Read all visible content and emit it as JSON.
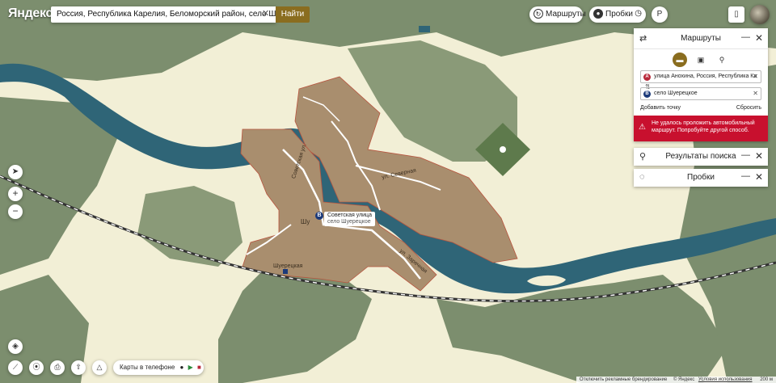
{
  "brand": {
    "logo": "Яндекс"
  },
  "search": {
    "value": "Россия, Республика Карелия, Беломорский район, село Шу",
    "button": "Найти"
  },
  "top_controls": {
    "routes": "Маршруты",
    "traffic": "Пробки"
  },
  "map_labels": {
    "place": "Шу",
    "station": "Шуерецкая",
    "street_sovet": "Советская ул.",
    "street_east": "ул. Северная",
    "street_se": "ул. Заречная",
    "marker_line1": "Советская улица",
    "marker_line2": "село Шуерецкое"
  },
  "routes_panel": {
    "title": "Маршруты",
    "waypoint_a": "улица Анохина, Россия, Республика Ка",
    "waypoint_b": "село Шуерецкое",
    "add_point": "Добавить точку",
    "reset": "Сбросить",
    "error": "Не удалось проложить автомобильный маршрут. Попробуйте другой способ."
  },
  "search_results_panel": {
    "title": "Результаты поиска"
  },
  "traffic_panel": {
    "title": "Пробки"
  },
  "bottom": {
    "phone_label": "Карты в телефоне"
  },
  "footer": {
    "ads": "Отключить рекламные брендирование",
    "copyright": "© Яндекс",
    "terms": "Условия использования",
    "scale": "200 м"
  },
  "colors": {
    "water": "#2f6577",
    "forest": "#7c8e6e",
    "field": "#f2efd6",
    "built": "#a98e6e",
    "accent": "#8a6d1f",
    "error": "#c8102e"
  }
}
